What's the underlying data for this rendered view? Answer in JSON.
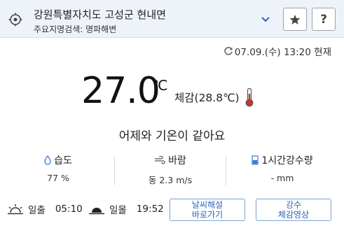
{
  "header": {
    "location": "강원특별자치도 고성군 현내면",
    "subtitle": "주요지명검색: 명파해변"
  },
  "timestamp": "07.09.(수) 13:20 현재",
  "current": {
    "temperature": "27.0",
    "unit": "℃",
    "feels_like": "체감(28.8℃)",
    "comparison": "어제와 기온이 같아요"
  },
  "stats": [
    {
      "label": "습도",
      "value": "77 %"
    },
    {
      "label": "바람",
      "value": "동 2.3 m/s"
    },
    {
      "label": "1시간강수량",
      "value": "- mm"
    }
  ],
  "sun": {
    "sunrise_label": "일출",
    "sunrise_time": "05:10",
    "sunset_label": "일몰",
    "sunset_time": "19:52"
  },
  "buttons": {
    "analysis_line1": "날씨해설",
    "analysis_line2": "바로가기",
    "video_line1": "강수",
    "video_line2": "체감영상"
  },
  "colors": {
    "header_bg": "#eef3fa",
    "link_blue": "#2c64b3",
    "thermo_red": "#c0392b"
  }
}
